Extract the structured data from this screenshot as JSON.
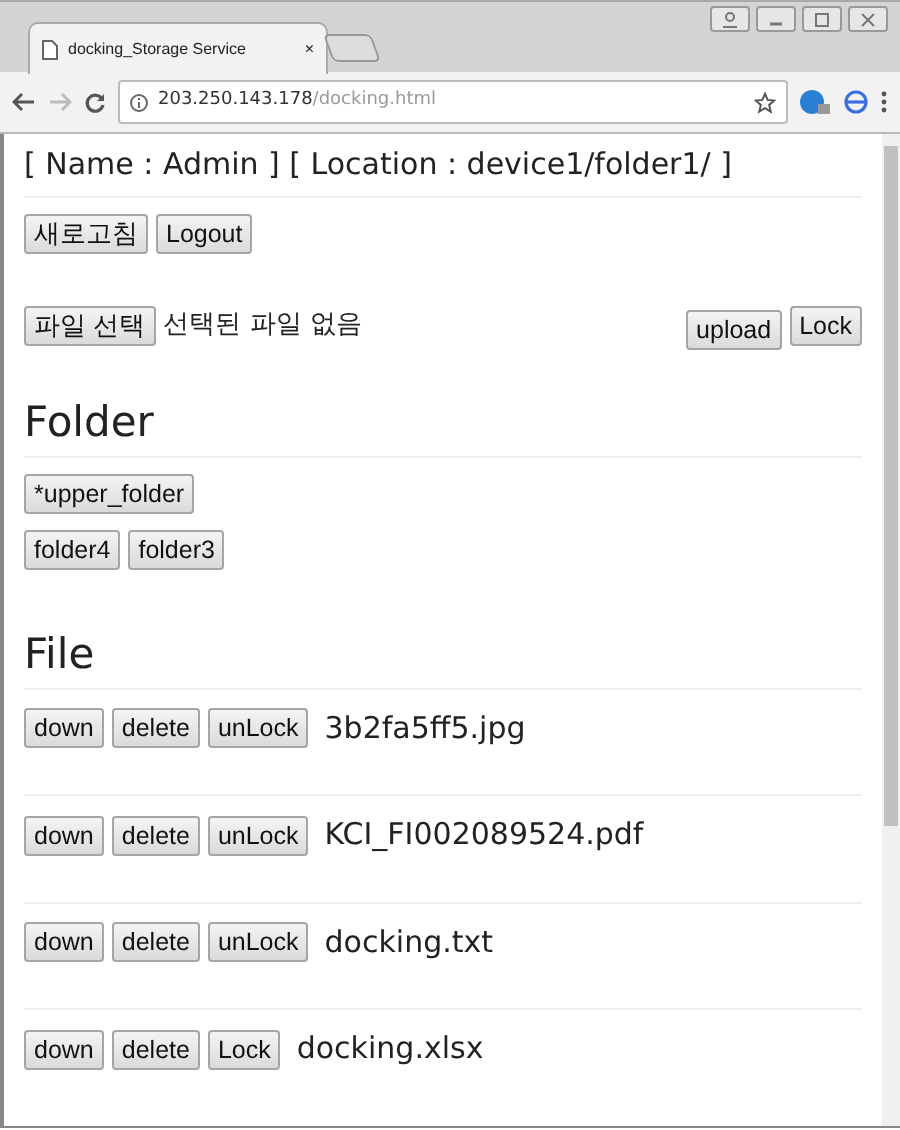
{
  "window": {
    "tab_title": "docking_Storage Service",
    "tab_close": "×"
  },
  "address_bar": {
    "host": "203.250.143.178",
    "path": "/docking.html"
  },
  "page": {
    "header": "[ Name : Admin ] [ Location : device1/folder1/ ]",
    "top_buttons": [
      "새로고침",
      "Logout"
    ],
    "file_picker": {
      "button": "파일 선택",
      "status": "선택된 파일 없음"
    },
    "upload_buttons": [
      "upload",
      "Lock"
    ],
    "folder_heading": "Folder",
    "upper_folder": "*upper_folder",
    "folders": [
      "folder4",
      "folder3"
    ],
    "file_heading": "File",
    "files": [
      {
        "actions": [
          "down",
          "delete",
          "unLock"
        ],
        "name": "3b2fa5ff5.jpg"
      },
      {
        "actions": [
          "down",
          "delete",
          "unLock"
        ],
        "name": "KCI_FI002089524.pdf"
      },
      {
        "actions": [
          "down",
          "delete",
          "unLock"
        ],
        "name": "docking.txt"
      },
      {
        "actions": [
          "down",
          "delete",
          "Lock"
        ],
        "name": "docking.xlsx"
      }
    ]
  }
}
